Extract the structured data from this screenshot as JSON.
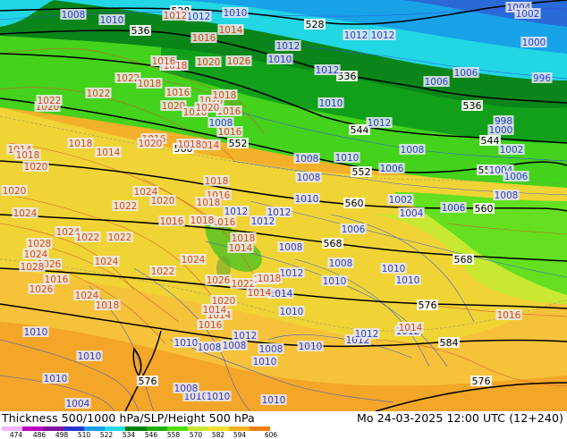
{
  "footer": {
    "title": "Thickness 500/1000 hPa/SLP/Height 500 hPa",
    "datetime": "Mo 24-03-2025 12:00 UTC (12+240)"
  },
  "legend": {
    "tick_labels": [
      "474",
      "486",
      "498",
      "510",
      "522",
      "534",
      "546",
      "558",
      "570",
      "582",
      "594",
      "606"
    ],
    "colors": [
      "#f0b4ff",
      "#c000c0",
      "#8010a0",
      "#2838d0",
      "#18a0e8",
      "#20d8e8",
      "#008000",
      "#20b000",
      "#50e000",
      "#c8e830",
      "#f0e030",
      "#f0b020",
      "#f08010"
    ]
  },
  "map_labels": {
    "height500": [
      {
        "text": "528"
      },
      {
        "text": "528"
      },
      {
        "text": "536"
      },
      {
        "text": "536"
      },
      {
        "text": "536"
      },
      {
        "text": "544"
      },
      {
        "text": "544"
      },
      {
        "text": "552"
      },
      {
        "text": "552"
      },
      {
        "text": "552"
      },
      {
        "text": "560"
      },
      {
        "text": "560"
      },
      {
        "text": "560"
      },
      {
        "text": "568"
      },
      {
        "text": "568"
      },
      {
        "text": "576"
      },
      {
        "text": "576"
      },
      {
        "text": "584"
      },
      {
        "text": "576"
      }
    ],
    "slp_blue": [
      {
        "text": "1008"
      },
      {
        "text": "1010"
      },
      {
        "text": "1010"
      },
      {
        "text": "1012"
      },
      {
        "text": "1012"
      },
      {
        "text": "1004"
      },
      {
        "text": "1002"
      },
      {
        "text": "1000"
      },
      {
        "text": "1012"
      },
      {
        "text": "1012"
      },
      {
        "text": "1010"
      },
      {
        "text": "1006"
      },
      {
        "text": "996"
      },
      {
        "text": "1012"
      },
      {
        "text": "1006"
      },
      {
        "text": "1008"
      },
      {
        "text": "1010"
      },
      {
        "text": "998"
      },
      {
        "text": "1000"
      },
      {
        "text": "1002"
      },
      {
        "text": "1012"
      },
      {
        "text": "1008"
      },
      {
        "text": "1010"
      },
      {
        "text": "1006"
      },
      {
        "text": "1008"
      },
      {
        "text": "1004"
      },
      {
        "text": "1006"
      },
      {
        "text": "1008"
      },
      {
        "text": "1010"
      },
      {
        "text": "1008"
      },
      {
        "text": "1002"
      },
      {
        "text": "1004"
      },
      {
        "text": "1006"
      },
      {
        "text": "1012"
      },
      {
        "text": "1012"
      },
      {
        "text": "1006"
      },
      {
        "text": "1008"
      },
      {
        "text": "1008"
      },
      {
        "text": "1010"
      },
      {
        "text": "1010"
      },
      {
        "text": "1010"
      },
      {
        "text": "1012"
      },
      {
        "text": "1014"
      },
      {
        "text": "1012"
      },
      {
        "text": "1010"
      },
      {
        "text": "1012"
      },
      {
        "text": "1008"
      },
      {
        "text": "1008"
      },
      {
        "text": "1010"
      },
      {
        "text": "1010"
      },
      {
        "text": "1010"
      },
      {
        "text": "1012"
      },
      {
        "text": "1010"
      },
      {
        "text": "1012"
      },
      {
        "text": "1012"
      },
      {
        "text": "1010"
      },
      {
        "text": "1010"
      },
      {
        "text": "1008"
      },
      {
        "text": "1008"
      },
      {
        "text": "1010"
      },
      {
        "text": "1010"
      },
      {
        "text": "1010"
      },
      {
        "text": "1004"
      }
    ],
    "slp_red": [
      {
        "text": "1012"
      },
      {
        "text": "1016"
      },
      {
        "text": "1014"
      },
      {
        "text": "1018"
      },
      {
        "text": "1020"
      },
      {
        "text": "1026"
      },
      {
        "text": "1022"
      },
      {
        "text": "1020"
      },
      {
        "text": "1018"
      },
      {
        "text": "1016"
      },
      {
        "text": "1020"
      },
      {
        "text": "1016"
      },
      {
        "text": "1022"
      },
      {
        "text": "1018"
      },
      {
        "text": "1022"
      },
      {
        "text": "1020"
      },
      {
        "text": "1016"
      },
      {
        "text": "1018"
      },
      {
        "text": "1016"
      },
      {
        "text": "1020"
      },
      {
        "text": "1016"
      },
      {
        "text": "1014"
      },
      {
        "text": "1018"
      },
      {
        "text": "1014"
      },
      {
        "text": "1018"
      },
      {
        "text": "1016"
      },
      {
        "text": "1020"
      },
      {
        "text": "1014"
      },
      {
        "text": "1020"
      },
      {
        "text": "1018"
      },
      {
        "text": "1020"
      },
      {
        "text": "1024"
      },
      {
        "text": "1020"
      },
      {
        "text": "1016"
      },
      {
        "text": "1018"
      },
      {
        "text": "1016"
      },
      {
        "text": "1022"
      },
      {
        "text": "1022"
      },
      {
        "text": "1018"
      },
      {
        "text": "1028"
      },
      {
        "text": "1024"
      },
      {
        "text": "1026"
      },
      {
        "text": "1024"
      },
      {
        "text": "1028"
      },
      {
        "text": "1022"
      },
      {
        "text": "1024"
      },
      {
        "text": "1016"
      },
      {
        "text": "1024"
      },
      {
        "text": "1026"
      },
      {
        "text": "1024"
      },
      {
        "text": "1022"
      },
      {
        "text": "1024"
      },
      {
        "text": "1026"
      },
      {
        "text": "1022"
      },
      {
        "text": "1014"
      },
      {
        "text": "1020"
      },
      {
        "text": "1018"
      },
      {
        "text": "1016"
      },
      {
        "text": "1014"
      },
      {
        "text": "1016"
      },
      {
        "text": "1014"
      },
      {
        "text": "1018"
      },
      {
        "text": "1018"
      },
      {
        "text": "1014"
      },
      {
        "text": "1016"
      },
      {
        "text": "1018"
      },
      {
        "text": "1014"
      },
      {
        "text": "1016"
      }
    ]
  }
}
